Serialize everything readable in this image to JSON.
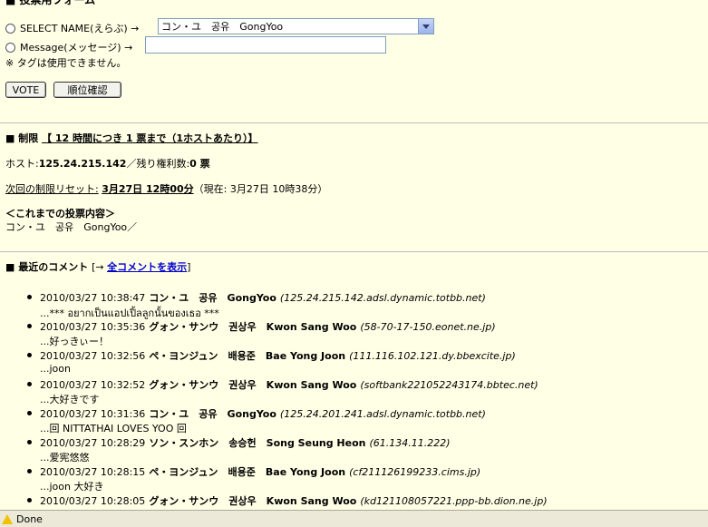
{
  "form": {
    "title": "■ 投票用フォーム",
    "select_label": "SELECT NAME(えらぶ) →",
    "select_value": "コン・ユ　공유　GongYoo",
    "message_label": "Message(メッセージ) →",
    "message_value": "",
    "note": "※ タグは使用できません。",
    "vote_button": "VOTE",
    "rank_button": "順位確認"
  },
  "limit": {
    "heading_prefix": "■ 制限",
    "heading_rule": "【 12 時間につき 1 票まで（1ホストあたり）】",
    "host_label": "ホスト:",
    "host_value": "125.24.215.142",
    "remaining_label": "／残り権利数:",
    "remaining_value": "0 票",
    "reset_label": "次回の制限リセット:",
    "reset_value": "3月27日 12時00分",
    "now_text": "（現在: 3月27日 10時38分）",
    "history_heading": "＜これまでの投票内容＞",
    "history_value": "コン・ユ　공유　GongYoo／"
  },
  "comments_section": {
    "heading": "■ 最近のコメント",
    "link_prefix": "[→ ",
    "link_label": "全コメントを表示",
    "link_suffix": "]",
    "items": [
      {
        "time": "2010/03/27 10:38:47",
        "name": "コン・ユ　공유　GongYoo",
        "host": "(125.24.215.142.adsl.dynamic.totbb.net)",
        "text": "...*** อยากเป็นแอปเปิ้ลลูกนั้นของเธอ ***"
      },
      {
        "time": "2010/03/27 10:35:36",
        "name": "グォン・サンウ　권상우　Kwon Sang Woo",
        "host": "(58-70-17-150.eonet.ne.jp)",
        "text": "...好っきぃー！"
      },
      {
        "time": "2010/03/27 10:32:56",
        "name": "ペ・ヨンジュン　배용준　Bae Yong Joon",
        "host": "(111.116.102.121.dy.bbexcite.jp)",
        "text": "...joon"
      },
      {
        "time": "2010/03/27 10:32:52",
        "name": "グォン・サンウ　권상우　Kwon Sang Woo",
        "host": "(softbank221052243174.bbtec.net)",
        "text": "...大好きです"
      },
      {
        "time": "2010/03/27 10:31:36",
        "name": "コン・ユ　공유　GongYoo",
        "host": "(125.24.201.241.adsl.dynamic.totbb.net)",
        "text": "...回 NITTATHAI LOVES YOO 回"
      },
      {
        "time": "2010/03/27 10:28:29",
        "name": "ソン・スンホン　송승헌　Song Seung Heon",
        "host": "(61.134.11.222)",
        "text": "...爱宪悠悠"
      },
      {
        "time": "2010/03/27 10:28:15",
        "name": "ペ・ヨンジュン　배용준　Bae Yong Joon",
        "host": "(cf211126199233.cims.jp)",
        "text": "...joon 大好き"
      },
      {
        "time": "2010/03/27 10:28:05",
        "name": "グォン・サンウ　권상우　Kwon Sang Woo",
        "host": "(kd121108057221.ppp-bb.dion.ne.jp)",
        "text": ""
      }
    ]
  },
  "statusbar": {
    "icon": "warning-icon",
    "text": "Done"
  }
}
